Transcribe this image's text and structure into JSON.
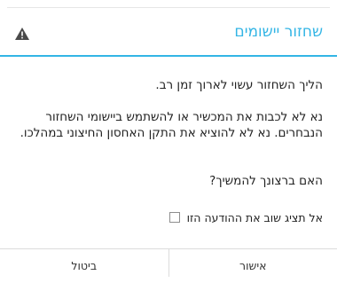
{
  "dialog": {
    "title": "שחזור יישומים",
    "warning_icon": "warning-triangle-icon",
    "paragraphs": [
      "הליך השחזור עשוי לארוך זמן רב.",
      "נא לא לכבות את המכשיר או להשתמש ביישומי השחזור הנבחרים. נא לא להוציא את התקן האחסון החיצוני במהלכו.",
      "האם ברצונך להמשיך?"
    ],
    "checkbox_label": "אל תציג שוב את ההודעה הזו",
    "checkbox_checked": false,
    "buttons": {
      "cancel": "ביטול",
      "confirm": "אישור"
    },
    "colors": {
      "accent": "#33b5e5",
      "text": "#222222",
      "icon": "#4a4a4a"
    }
  }
}
